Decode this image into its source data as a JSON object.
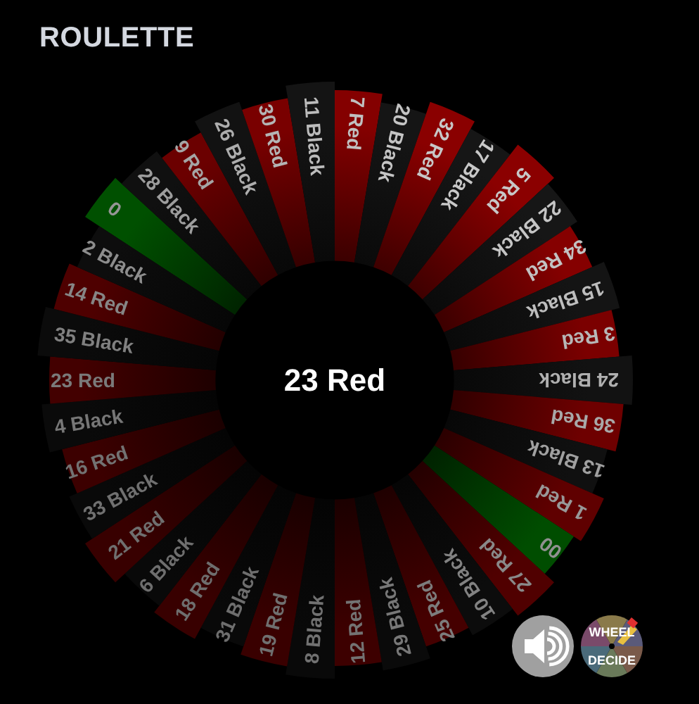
{
  "title": "ROULETTE",
  "wheel": {
    "result": "23 Red",
    "segments": [
      {
        "label": "0",
        "kind": "green"
      },
      {
        "label": "28 Black",
        "kind": "black"
      },
      {
        "label": "9 Red",
        "kind": "red"
      },
      {
        "label": "26 Black",
        "kind": "black"
      },
      {
        "label": "30 Red",
        "kind": "red"
      },
      {
        "label": "11 Black",
        "kind": "black"
      },
      {
        "label": "7 Red",
        "kind": "red"
      },
      {
        "label": "20 Black",
        "kind": "black"
      },
      {
        "label": "32 Red",
        "kind": "red"
      },
      {
        "label": "17 Black",
        "kind": "black"
      },
      {
        "label": "5 Red",
        "kind": "red"
      },
      {
        "label": "22 Black",
        "kind": "black"
      },
      {
        "label": "34 Red",
        "kind": "red"
      },
      {
        "label": "15 Black",
        "kind": "black"
      },
      {
        "label": "3 Red",
        "kind": "red"
      },
      {
        "label": "24 Black",
        "kind": "black"
      },
      {
        "label": "36 Red",
        "kind": "red"
      },
      {
        "label": "13 Black",
        "kind": "black"
      },
      {
        "label": "1 Red",
        "kind": "red"
      },
      {
        "label": "00",
        "kind": "green"
      },
      {
        "label": "27 Red",
        "kind": "red"
      },
      {
        "label": "10 Black",
        "kind": "black"
      },
      {
        "label": "25 Red",
        "kind": "red"
      },
      {
        "label": "29 Black",
        "kind": "black"
      },
      {
        "label": "12 Red",
        "kind": "red"
      },
      {
        "label": "8 Black",
        "kind": "black"
      },
      {
        "label": "19 Red",
        "kind": "red"
      },
      {
        "label": "31 Black",
        "kind": "black"
      },
      {
        "label": "18 Red",
        "kind": "red"
      },
      {
        "label": "6 Black",
        "kind": "black"
      },
      {
        "label": "21 Red",
        "kind": "red"
      },
      {
        "label": "33 Black",
        "kind": "black"
      },
      {
        "label": "16 Red",
        "kind": "red"
      },
      {
        "label": "4 Black",
        "kind": "black"
      },
      {
        "label": "23 Red",
        "kind": "red"
      },
      {
        "label": "35 Black",
        "kind": "black"
      },
      {
        "label": "14 Red",
        "kind": "red"
      },
      {
        "label": "2 Black",
        "kind": "black"
      }
    ]
  },
  "sound": {
    "muted": false
  },
  "logo": {
    "line_1": "WHEEL",
    "line_2": "DECIDE"
  }
}
